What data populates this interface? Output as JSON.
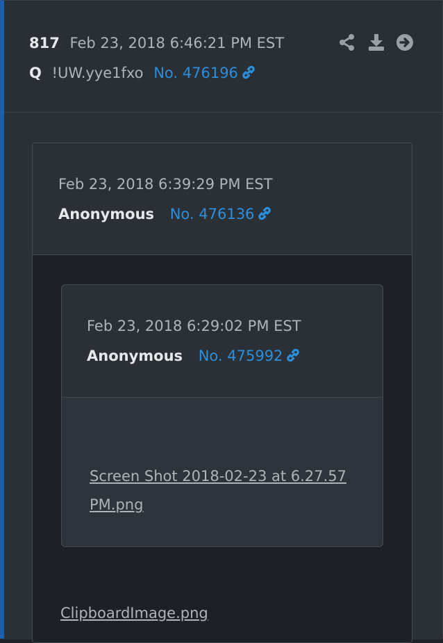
{
  "post": {
    "number": "817",
    "timestamp": "Feb 23, 2018 6:46:21 PM EST",
    "author": "Q",
    "tripcode": "!UW.yye1fxo",
    "post_no": "No. 476196",
    "actions": [
      "share-icon",
      "download-icon",
      "arrow-circle-right-icon"
    ]
  },
  "quote": {
    "timestamp": "Feb 23, 2018 6:39:29 PM EST",
    "author": "Anonymous",
    "post_no": "No. 476136",
    "file": "ClipboardImage.png",
    "nested": {
      "timestamp": "Feb 23, 2018 6:29:02 PM EST",
      "author": "Anonymous",
      "post_no": "No. 475992",
      "file": "Screen Shot 2018-02-23 at 6.27.57 PM.png"
    }
  },
  "colors": {
    "accent_border": "#1d5ea8",
    "link": "#2a8fdc",
    "icon": "#9aa0a6"
  }
}
